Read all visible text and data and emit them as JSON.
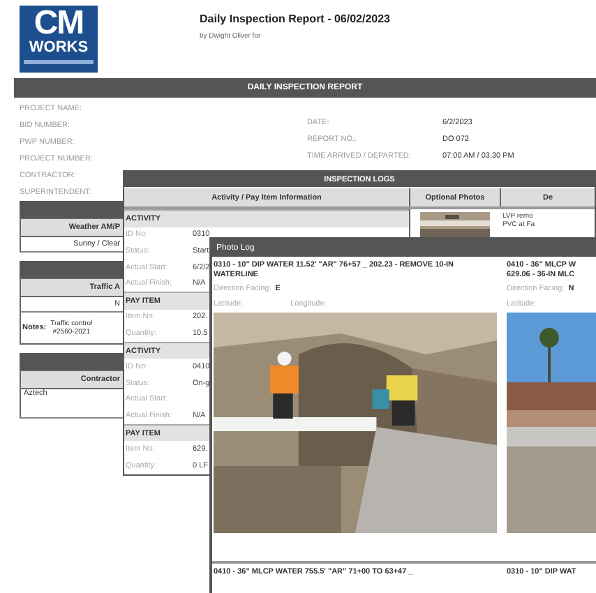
{
  "report": {
    "logo": {
      "main": "CM",
      "sub": "WORKS"
    },
    "title": "Daily Inspection Report - 06/02/2023",
    "byline": "by Dwight Oliver for",
    "banner": "DAILY INSPECTION REPORT",
    "fields_left": [
      "PROJECT NAME:",
      "BID NUMBER:",
      "PWP NUMBER:",
      "PROJECT NUMBER:",
      "CONTRACTOR:",
      "SUPERINTENDENT:"
    ],
    "fields_right": [
      {
        "label": "DATE:",
        "value": "6/2/2023"
      },
      {
        "label": "REPORT NO.:",
        "value": "DO 072"
      },
      {
        "label": "TIME ARRIVED / DEPARTED:",
        "value": "07:00 AM / 03:30 PM"
      }
    ],
    "sections": [
      {
        "kind": "simple",
        "header": "Weather AM/P",
        "value": "Sunny / Clear"
      },
      {
        "kind": "notes",
        "header": "Traffic A",
        "value": "N",
        "notes_label": "Notes:",
        "notes": [
          "Traffic control",
          "#2560-2021"
        ]
      },
      {
        "kind": "simple",
        "header": "Contractor",
        "value": "Aztech"
      }
    ]
  },
  "inspection_logs": {
    "title": "INSPECTION LOGS",
    "columns": [
      "Activity / Pay Item Information",
      "Optional Photos",
      "De"
    ],
    "rows": [
      {
        "kind": "section",
        "label": "ACTIVITY"
      },
      {
        "kind": "field",
        "label": "ID No:",
        "value": "0310"
      },
      {
        "kind": "field",
        "label": "Status:",
        "value": "Start"
      },
      {
        "kind": "field",
        "label": "Actual Start:",
        "value": "6/2/2"
      },
      {
        "kind": "field",
        "label": "Actual Finish:",
        "value": "N/A"
      },
      {
        "kind": "section",
        "label": "PAY ITEM"
      },
      {
        "kind": "field",
        "label": "Item No:",
        "value": "202."
      },
      {
        "kind": "field",
        "label": "Quantity:",
        "value": "10.5"
      },
      {
        "kind": "section",
        "label": "ACTIVITY"
      },
      {
        "kind": "field",
        "label": "ID No:",
        "value": "0410"
      },
      {
        "kind": "field",
        "label": "Status:",
        "value": "On-g"
      },
      {
        "kind": "field",
        "label": "Actual Start:"
      },
      {
        "kind": "field",
        "label": "Actual Finish:",
        "value": "N/A"
      },
      {
        "kind": "section",
        "label": "PAY ITEM"
      },
      {
        "kind": "field",
        "label": "Item No:",
        "value": "629."
      },
      {
        "kind": "field",
        "label": "Quantity:",
        "value": "0 LF"
      }
    ],
    "description": [
      "LVP remo",
      "PVC at Fa"
    ]
  },
  "photo_log": {
    "title": "Photo Log",
    "cards": [
      {
        "caption": "0310 - 10\" DIP WATER 11.52' \"AR\" 76+57 _ 202.23 - REMOVE 10-IN WATERLINE",
        "facing_label": "Direction Facing:",
        "facing": "E",
        "latitude": "Latitude:",
        "longitude": "Longitude:",
        "kind": "picture"
      },
      {
        "caption_lines": [
          "0410 - 36\" MLCP W",
          "629.06 - 36-IN MLC"
        ],
        "facing_label": "Direction Facing:",
        "facing": "N",
        "latitude": "Latitude:",
        "kind": "picture"
      }
    ],
    "footer": [
      "0410 - 36\" MLCP WATER 755.5' \"AR\" 71+00 TO 63+47 _",
      "0310 - 10\" DIP WAT"
    ]
  }
}
